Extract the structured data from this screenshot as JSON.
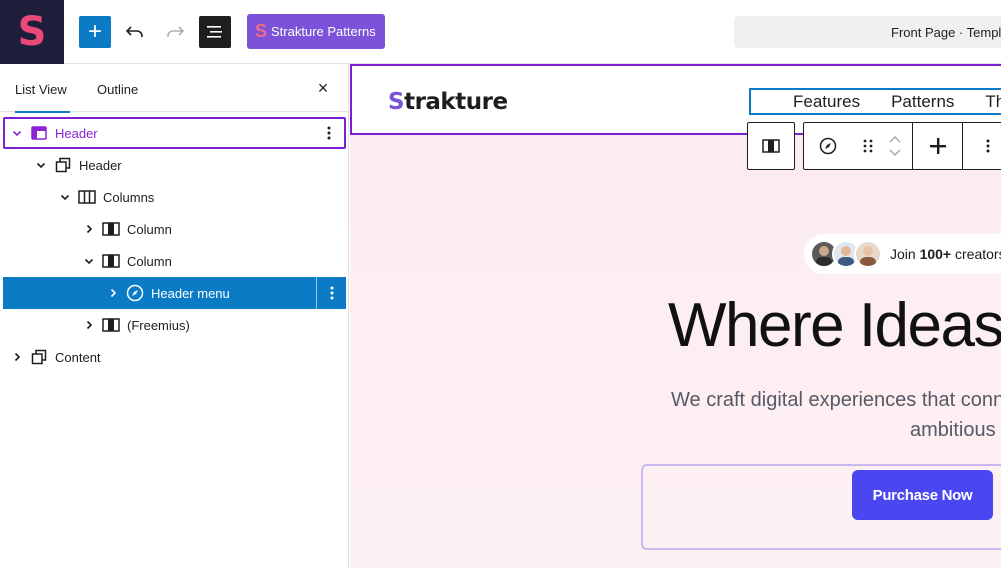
{
  "topbar": {
    "site_logo_letter": "S",
    "add_block_label": "+",
    "patterns_button": {
      "logo_letter": "S",
      "label": "Strakture Patterns"
    },
    "document_title": "Front Page · Template"
  },
  "panel": {
    "tabs": [
      {
        "label": "List View",
        "active": true
      },
      {
        "label": "Outline",
        "active": false
      }
    ],
    "close_label": "×",
    "tree": [
      {
        "label": "Header",
        "depth": 0,
        "expanded": true,
        "icon": "template-part-icon",
        "state": "selected-parent"
      },
      {
        "label": "Header",
        "depth": 1,
        "expanded": true,
        "icon": "group-icon",
        "state": ""
      },
      {
        "label": "Columns",
        "depth": 2,
        "expanded": true,
        "icon": "columns-icon",
        "state": ""
      },
      {
        "label": "Column",
        "depth": 3,
        "expanded": false,
        "icon": "column-icon",
        "state": ""
      },
      {
        "label": "Column",
        "depth": 3,
        "expanded": true,
        "icon": "column-icon",
        "state": ""
      },
      {
        "label": "Header menu",
        "depth": 4,
        "expanded": false,
        "icon": "navigation-icon",
        "state": "selected"
      },
      {
        "label": "(Freemius)",
        "depth": 3,
        "expanded": false,
        "icon": "column-icon",
        "state": ""
      },
      {
        "label": "Content",
        "depth": 0,
        "expanded": false,
        "icon": "group-icon",
        "state": ""
      }
    ]
  },
  "canvas": {
    "brand": {
      "first_letter": "S",
      "rest": "trakture"
    },
    "nav_items": [
      "Features",
      "Patterns",
      "Th"
    ],
    "creators": {
      "prefix": "Join ",
      "count": "100+",
      "suffix": " creators"
    },
    "hero_title": "Where Ideas",
    "hero_sub_line1": "We craft digital experiences that conne",
    "hero_sub_line2": "ambitious b",
    "purchase_button": "Purchase Now"
  },
  "colors": {
    "accent_blue": "#0a7bc4",
    "selection_purple": "#7b1fd1",
    "patterns_purple": "#7b52d8",
    "purchase_blue": "#4a46f0"
  }
}
